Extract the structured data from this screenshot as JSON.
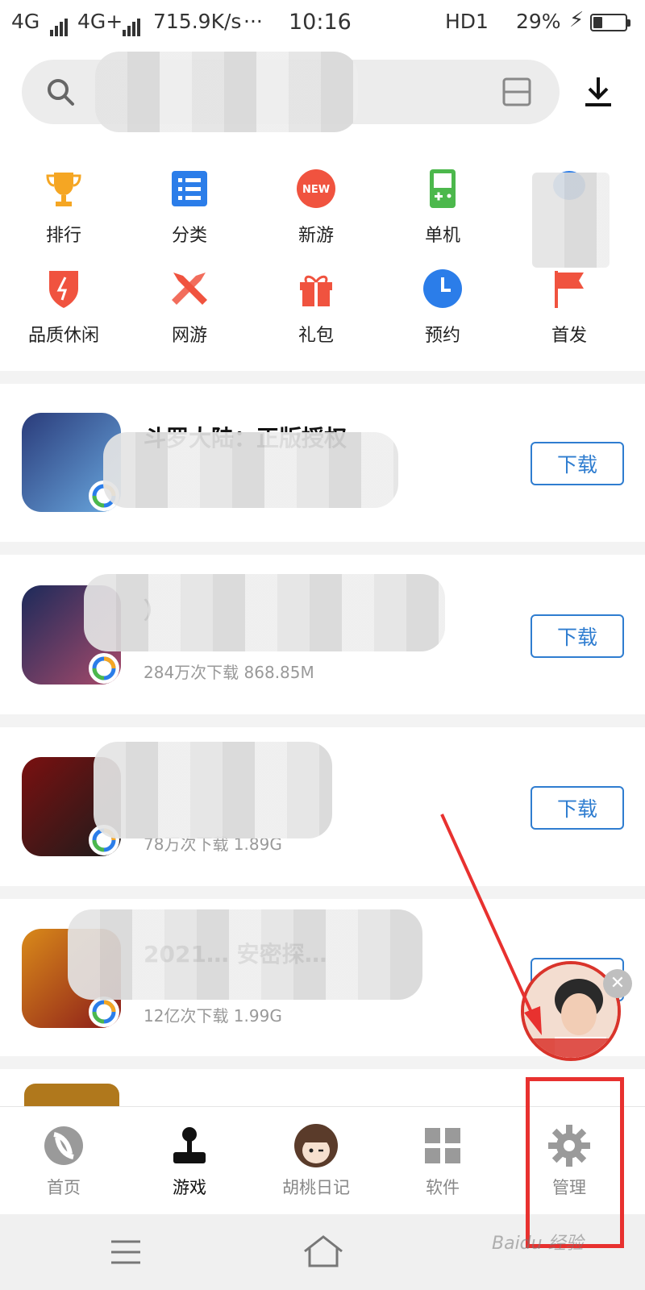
{
  "status_bar": {
    "net1": "4G",
    "net2": "4G+",
    "speed": "715.9K/s",
    "dots": "···",
    "time": "10:16",
    "hd": "HD1",
    "battery": "29%",
    "battery_level": 0.29
  },
  "search": {
    "placeholder": ""
  },
  "categories": [
    {
      "label": "排行",
      "icon": "trophy-icon",
      "color": "#f5a623"
    },
    {
      "label": "分类",
      "icon": "list-icon",
      "color": "#2b7de9"
    },
    {
      "label": "新游",
      "icon": "new-badge-icon",
      "color": "#f0533f",
      "badge": "NEW"
    },
    {
      "label": "单机",
      "icon": "gameboy-icon",
      "color": "#4cb84c"
    },
    {
      "label": "",
      "icon": "bubble-icon",
      "color": "#2b7de9"
    },
    {
      "label": "品质休闲",
      "icon": "shield-icon",
      "color": "#f0533f"
    },
    {
      "label": "网游",
      "icon": "swords-icon",
      "color": "#f0533f"
    },
    {
      "label": "礼包",
      "icon": "gift-icon",
      "color": "#f0533f"
    },
    {
      "label": "预约",
      "icon": "clock-icon",
      "color": "#2b7de9"
    },
    {
      "label": "首发",
      "icon": "flag-icon",
      "color": "#f0533f"
    }
  ],
  "games": [
    {
      "title": "斗罗大陆：正版授权",
      "meta": "",
      "button": "下载"
    },
    {
      "title": "）",
      "meta": "284万次下载   868.85M",
      "button": "下载"
    },
    {
      "title": "",
      "meta": "78万次下载   1.89G",
      "button": "下载"
    },
    {
      "title": "2021…                     安密探…",
      "meta": "12亿次下载   1.99G",
      "button": "下载"
    }
  ],
  "bottom_nav": [
    {
      "label": "首页",
      "icon": "home-swirl-icon",
      "active": false
    },
    {
      "label": "游戏",
      "icon": "joystick-icon",
      "active": true
    },
    {
      "label": "胡桃日记",
      "icon": "avatar-icon",
      "active": false
    },
    {
      "label": "软件",
      "icon": "apps-grid-icon",
      "active": false
    },
    {
      "label": "管理",
      "icon": "gear-icon",
      "active": false
    }
  ],
  "close_label": "✕",
  "watermark": "Baidu 经验",
  "accent": "#2f7dd0",
  "annotation_color": "#e8312f"
}
